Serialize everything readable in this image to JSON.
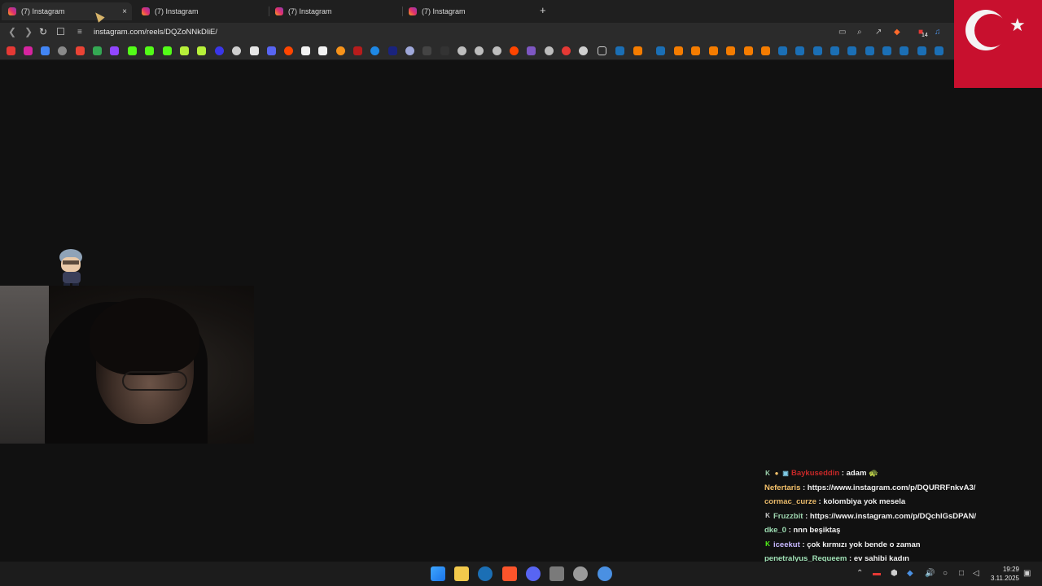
{
  "tabs": [
    {
      "label": "(7) Instagram",
      "active": true
    },
    {
      "label": "(7) Instagram",
      "active": false
    },
    {
      "label": "(7) Instagram",
      "active": false
    },
    {
      "label": "(7) Instagram",
      "active": false
    }
  ],
  "tab_close_glyph": "×",
  "new_tab_glyph": "+",
  "address_bar": {
    "url": "instagram.com/reels/DQZoNNkDliE/"
  },
  "extension_badge": "14",
  "chat": {
    "messages": [
      {
        "user": "Baykuseddin",
        "text": ": adam 🐢",
        "user_color": "#c62828",
        "badges": [
          "K",
          "●",
          "▣"
        ]
      },
      {
        "user": "Nefertaris",
        "text": ": https://www.instagram.com/p/DQURRFnkvA3/",
        "user_color": "#f5c26b",
        "badges": []
      },
      {
        "user": "cormac_curze",
        "text": ": kolombiya yok mesela",
        "user_color": "#e8b96a",
        "badges": []
      },
      {
        "user": "Fruzzbit",
        "text": ": https://www.instagram.com/p/DQchlGsDPAN/",
        "user_color": "#9fd6b0",
        "badges": [
          "K"
        ]
      },
      {
        "user": "dke_0",
        "text": ": nnn beşiktaş",
        "user_color": "#9fe0b5",
        "badges": []
      },
      {
        "user": "iceekut",
        "text": ": çok kırmızı yok bende o zaman",
        "user_color": "#c7b8ff",
        "badges": [
          "K"
        ]
      },
      {
        "user": "penetralyus_Requeem",
        "text": ": ev sahibi kadın",
        "user_color": "#9fe0b5",
        "badges": []
      }
    ]
  },
  "clock": {
    "time": "19:29",
    "date": "3.11.2025"
  },
  "colors": {
    "accent": "#2b2b2b",
    "flag_red": "#c8102e"
  }
}
